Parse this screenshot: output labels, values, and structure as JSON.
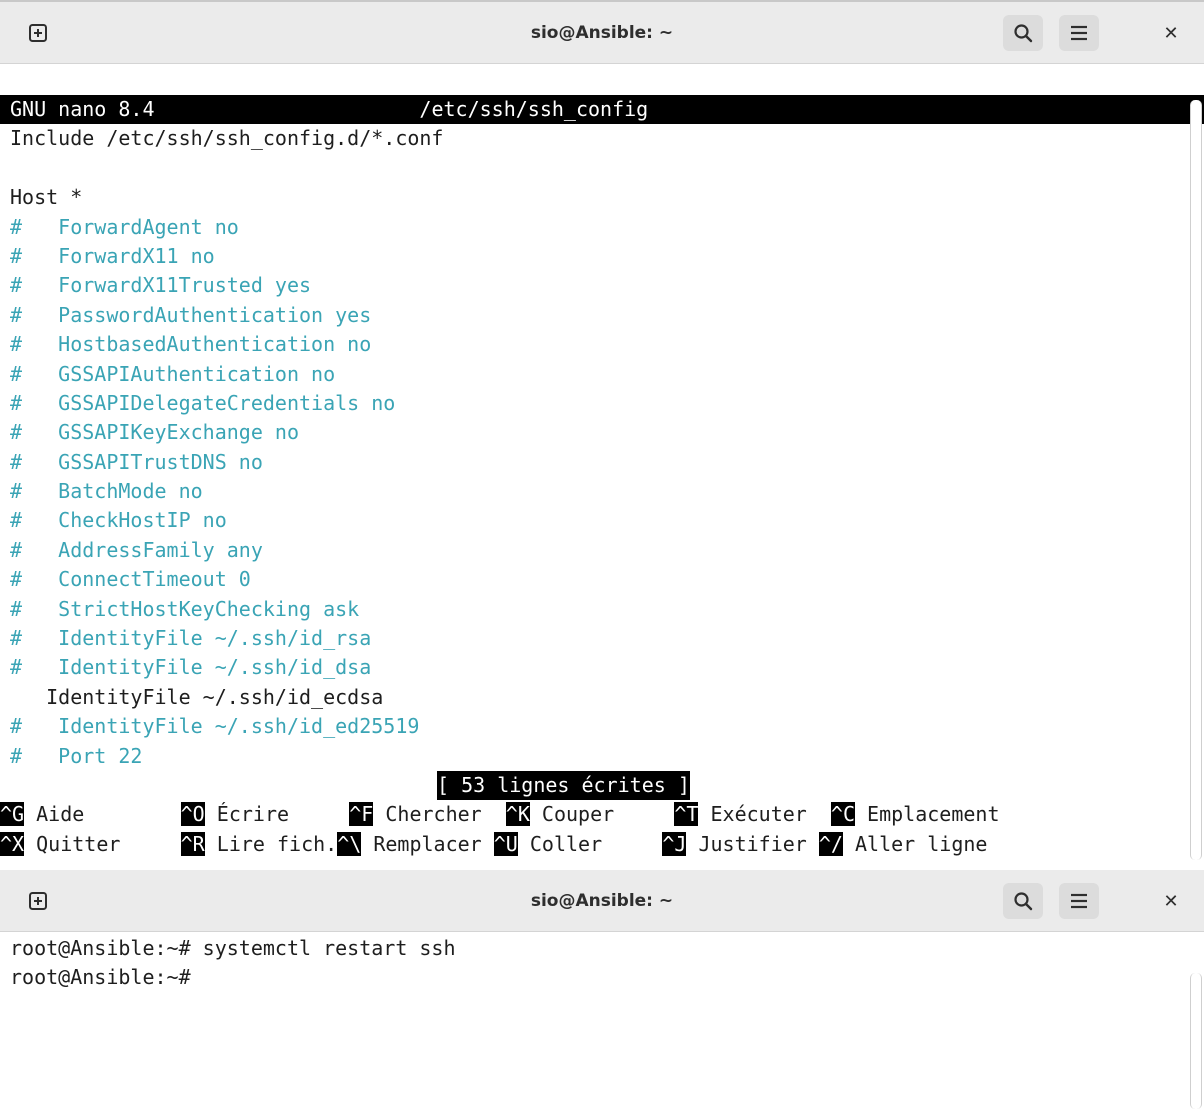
{
  "window1": {
    "title": "sio@Ansible: ~",
    "nano": {
      "header_app": "GNU nano 8.4",
      "header_file": "/etc/ssh/ssh_config",
      "lines": [
        {
          "text": "Include /etc/ssh/ssh_config.d/*.conf",
          "style": "normal"
        },
        {
          "text": "",
          "style": "normal"
        },
        {
          "text": "Host *",
          "style": "normal"
        },
        {
          "text": "#   ForwardAgent no",
          "style": "comment"
        },
        {
          "text": "#   ForwardX11 no",
          "style": "comment"
        },
        {
          "text": "#   ForwardX11Trusted yes",
          "style": "comment"
        },
        {
          "text": "#   PasswordAuthentication yes",
          "style": "comment"
        },
        {
          "text": "#   HostbasedAuthentication no",
          "style": "comment"
        },
        {
          "text": "#   GSSAPIAuthentication no",
          "style": "comment"
        },
        {
          "text": "#   GSSAPIDelegateCredentials no",
          "style": "comment"
        },
        {
          "text": "#   GSSAPIKeyExchange no",
          "style": "comment"
        },
        {
          "text": "#   GSSAPITrustDNS no",
          "style": "comment"
        },
        {
          "text": "#   BatchMode no",
          "style": "comment"
        },
        {
          "text": "#   CheckHostIP no",
          "style": "comment"
        },
        {
          "text": "#   AddressFamily any",
          "style": "comment"
        },
        {
          "text": "#   ConnectTimeout 0",
          "style": "comment"
        },
        {
          "text": "#   StrictHostKeyChecking ask",
          "style": "comment"
        },
        {
          "text": "#   IdentityFile ~/.ssh/id_rsa",
          "style": "comment"
        },
        {
          "text": "#   IdentityFile ~/.ssh/id_dsa",
          "style": "comment"
        },
        {
          "text": "   IdentityFile ~/.ssh/id_ecdsa",
          "style": "normal"
        },
        {
          "text": "#   IdentityFile ~/.ssh/id_ed25519",
          "style": "comment"
        },
        {
          "text": "#   Port 22",
          "style": "comment"
        }
      ],
      "status": "[ 53 lignes écrites ]",
      "shortcuts_row1": [
        {
          "key": "^G",
          "label": " Aide        "
        },
        {
          "key": "^O",
          "label": " Écrire     "
        },
        {
          "key": "^F",
          "label": " Chercher  "
        },
        {
          "key": "^K",
          "label": " Couper     "
        },
        {
          "key": "^T",
          "label": " Exécuter  "
        },
        {
          "key": "^C",
          "label": " Emplacement"
        }
      ],
      "shortcuts_row2": [
        {
          "key": "^X",
          "label": " Quitter     "
        },
        {
          "key": "^R",
          "label": " Lire fich."
        },
        {
          "key": "^\\",
          "label": " Remplacer "
        },
        {
          "key": "^U",
          "label": " Coller     "
        },
        {
          "key": "^J",
          "label": " Justifier "
        },
        {
          "key": "^/",
          "label": " Aller ligne"
        }
      ]
    }
  },
  "window2": {
    "title": "sio@Ansible: ~",
    "lines": [
      "root@Ansible:~# systemctl restart ssh",
      "root@Ansible:~# "
    ]
  },
  "icons": {
    "new_tab": "new-tab-icon",
    "search": "search-icon",
    "menu": "hamburger-menu-icon",
    "close": "close-icon"
  }
}
